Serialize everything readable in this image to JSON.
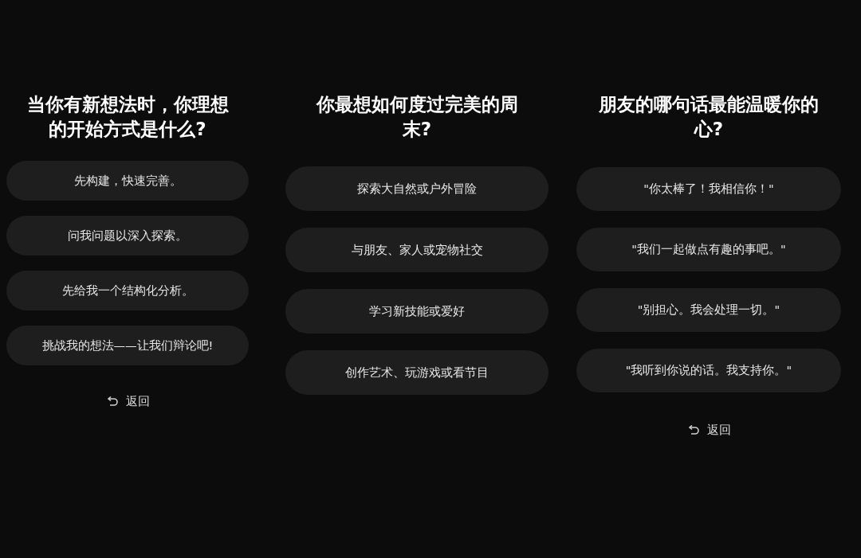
{
  "panels": [
    {
      "question": "当你有新想法时，你理想的开始方式是什么?",
      "options": [
        "先构建，快速完善。",
        "问我问题以深入探索。",
        "先给我一个结构化分析。",
        "挑战我的想法——让我们辩论吧!"
      ],
      "back": "返回"
    },
    {
      "question": "你最想如何度过完美的周末?",
      "options": [
        "探索大自然或户外冒险",
        "与朋友、家人或宠物社交",
        "学习新技能或爱好",
        "创作艺术、玩游戏或看节目"
      ]
    },
    {
      "question": "朋友的哪句话最能温暖你的心?",
      "options": [
        "\"你太棒了！我相信你！\"",
        "\"我们一起做点有趣的事吧。\"",
        "\"别担心。我会处理一切。\"",
        "\"我听到你说的话。我支持你。\""
      ],
      "back": "返回"
    }
  ]
}
